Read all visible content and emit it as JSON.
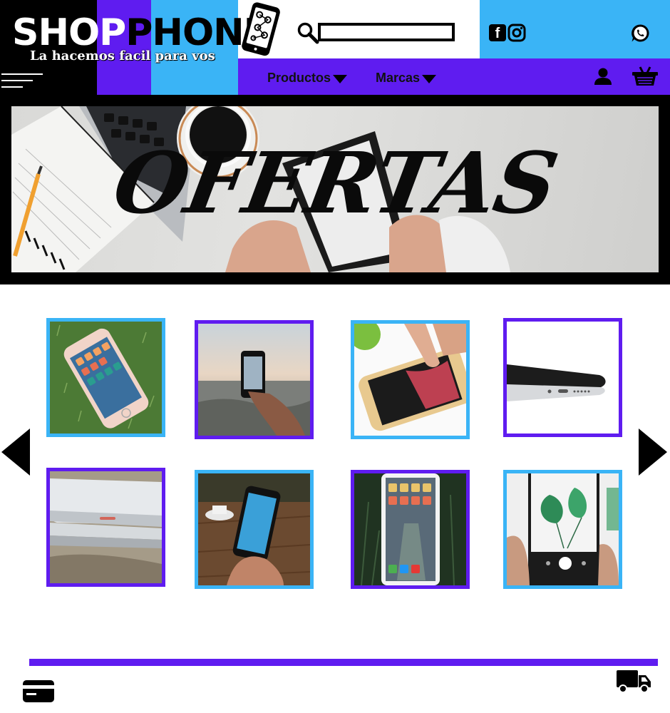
{
  "brand": {
    "logo_part1": "SHOP",
    "logo_part2": "HONE",
    "logo_first_p": "P",
    "tagline": "La hacemos facil para vos"
  },
  "search": {
    "placeholder": "",
    "value": ""
  },
  "nav": {
    "items": [
      {
        "label": "Productos"
      },
      {
        "label": "Marcas"
      }
    ]
  },
  "banner": {
    "title": "OFERTAS"
  },
  "social": {
    "facebook_glyph": "f"
  },
  "icons": [
    "hamburger-icon",
    "phone-logo-icon",
    "search-icon",
    "facebook-icon",
    "instagram-icon",
    "whatsapp-icon",
    "user-icon",
    "cart-icon",
    "left-arrow-icon",
    "right-arrow-icon",
    "credit-card-icon",
    "truck-icon"
  ],
  "products": [
    {
      "alt": "iPhone on grass",
      "border": "blue"
    },
    {
      "alt": "Phone at beach sunset",
      "border": "purple"
    },
    {
      "alt": "Finger tapping iPhone",
      "border": "blue"
    },
    {
      "alt": "Silver iPhone bottom edge",
      "border": "purple"
    },
    {
      "alt": "Stacked silver iPhones",
      "border": "purple"
    },
    {
      "alt": "Hand holding phone with coffee",
      "border": "blue"
    },
    {
      "alt": "iPhone home screen in forest",
      "border": "purple"
    },
    {
      "alt": "Phone camera with plant",
      "border": "blue"
    }
  ],
  "colors": {
    "purple": "#5f1cf0",
    "blue": "#3ab4f6",
    "black": "#000000"
  }
}
